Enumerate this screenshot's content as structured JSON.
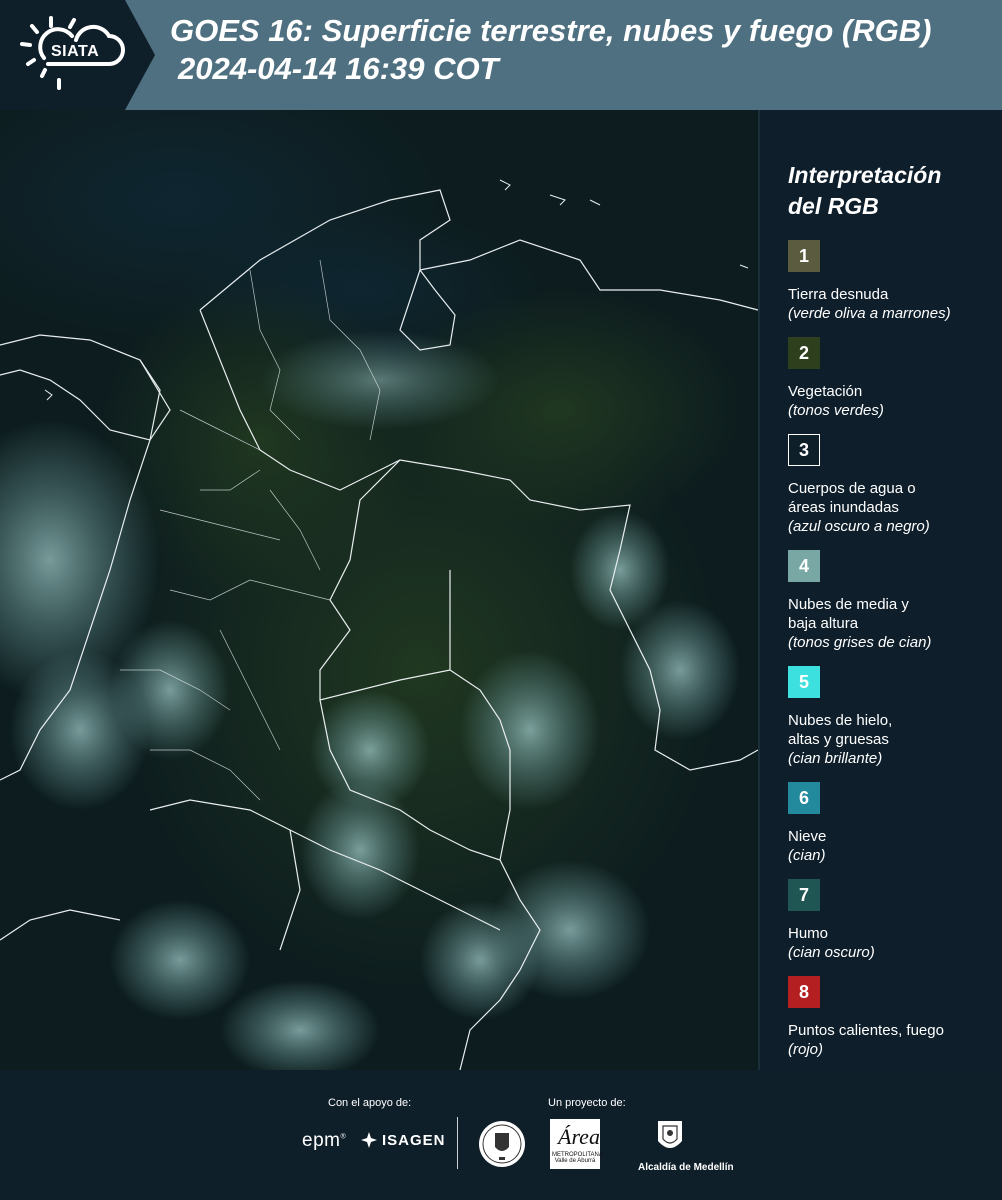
{
  "header": {
    "logo_text": "SIATA",
    "title_line1": "GOES 16: Superficie terrestre, nubes y fuego (RGB)",
    "title_line2": "2024-04-14 16:39 COT",
    "background_color": "#4e7080",
    "logo_background_color": "#0f1f2a"
  },
  "legend": {
    "title": "Interpretación\ndel RGB",
    "items": [
      {
        "number": "1",
        "color": "#5b5b40",
        "label": "Tierra desnuda",
        "sub": "(verde oliva a marrones)"
      },
      {
        "number": "2",
        "color": "#2e3f1d",
        "label": "Vegetación",
        "sub": "(tonos verdes)"
      },
      {
        "number": "3",
        "color": "#0f1f2a",
        "label": "Cuerpos de agua o\náreas inundadas",
        "sub": "(azul oscuro a negro)"
      },
      {
        "number": "4",
        "color": "#79a7a4",
        "label": "Nubes de media y\nbaja altura",
        "sub": "(tonos grises de cian)"
      },
      {
        "number": "5",
        "color": "#3ce0de",
        "label": "Nubes de hielo,\naltas y gruesas",
        "sub": "(cian brillante)"
      },
      {
        "number": "6",
        "color": "#23899c",
        "label": "Nieve",
        "sub": "(cian)"
      },
      {
        "number": "7",
        "color": "#1f5552",
        "label": "Humo",
        "sub": "(cian oscuro)"
      },
      {
        "number": "8",
        "color": "#b41f22",
        "label": "Puntos calientes, fuego",
        "sub": "(rojo)"
      }
    ]
  },
  "footer": {
    "support_label": "Con el apoyo de:",
    "project_label": "Un proyecto de:",
    "epm_text": "epm",
    "isagen_text": "ISAGEN",
    "medellin_text": "Alcaldía de Medellín",
    "area_big": "Área",
    "area_small": "METROPOLITANA Valle de Aburrá"
  }
}
